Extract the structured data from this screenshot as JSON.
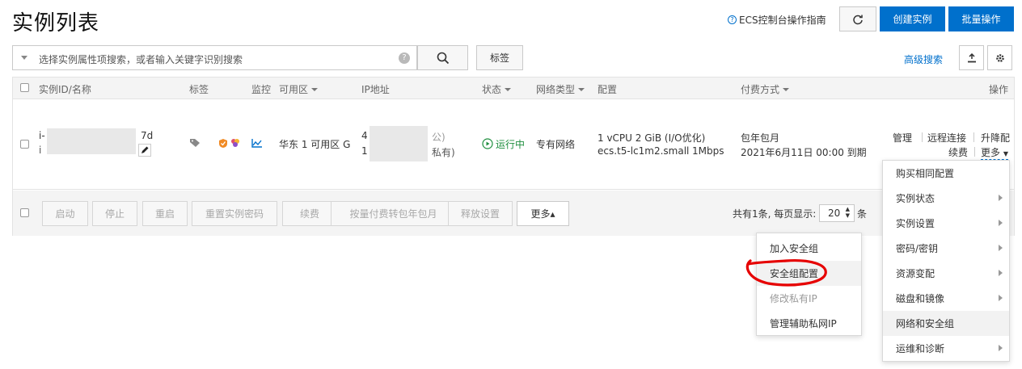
{
  "page": {
    "title": "实例列表"
  },
  "header": {
    "guide_label": "ECS控制台操作指南",
    "refresh_icon": "refresh-icon",
    "create_label": "创建实例",
    "batch_label": "批量操作"
  },
  "search": {
    "placeholder": "选择实例属性项搜索，或者输入关键字识别搜索",
    "tag_button": "标签",
    "advanced_label": "高级搜索"
  },
  "table": {
    "headers": {
      "id_name": "实例ID/名称",
      "tags": "标签",
      "monitor": "监控",
      "zone": "可用区",
      "ip": "IP地址",
      "status": "状态",
      "network": "网络类型",
      "config": "配置",
      "billing": "付费方式",
      "actions": "操作"
    },
    "row": {
      "id_prefix": "i-",
      "id_suffix": "7d",
      "name_prefix": "i",
      "zone": "华东 1 可用区 G",
      "ip_line1_prefix": "4",
      "ip_line1_suffix": "公)",
      "ip_line2_prefix": "1",
      "ip_line2_suffix": "私有)",
      "status": "运行中",
      "network": "专有网络",
      "config_line1": "1 vCPU 2 GiB (I/O优化)",
      "config_type": "ecs.t5-lc1m2.small",
      "config_bw": "1Mbps",
      "billing_line1": "包年包月",
      "billing_line2": "2021年6月11日 00:00 到期",
      "action_manage": "管理",
      "action_remote": "远程连接",
      "action_resize": "升降配",
      "action_renew": "续费",
      "action_more": "更多"
    }
  },
  "footer": {
    "buttons": [
      "启动",
      "停止",
      "重启",
      "重置实例密码",
      "续费",
      "按量付费转包年包月",
      "释放设置"
    ],
    "more_label": "更多▴",
    "pager_text": "共有1条, 每页显示:",
    "page_size": "20",
    "unit": "条"
  },
  "more_menu": {
    "items": [
      "购买相同配置",
      "实例状态",
      "实例设置",
      "密码/密钥",
      "资源变配",
      "磁盘和镜像",
      "网络和安全组",
      "运维和诊断"
    ]
  },
  "submenu": {
    "items": [
      "加入安全组",
      "安全组配置",
      "修改私有IP",
      "管理辅助私网IP"
    ]
  },
  "colors": {
    "accent": "#0070cc",
    "running": "#1e8e3e",
    "annotation": "#e60000"
  }
}
